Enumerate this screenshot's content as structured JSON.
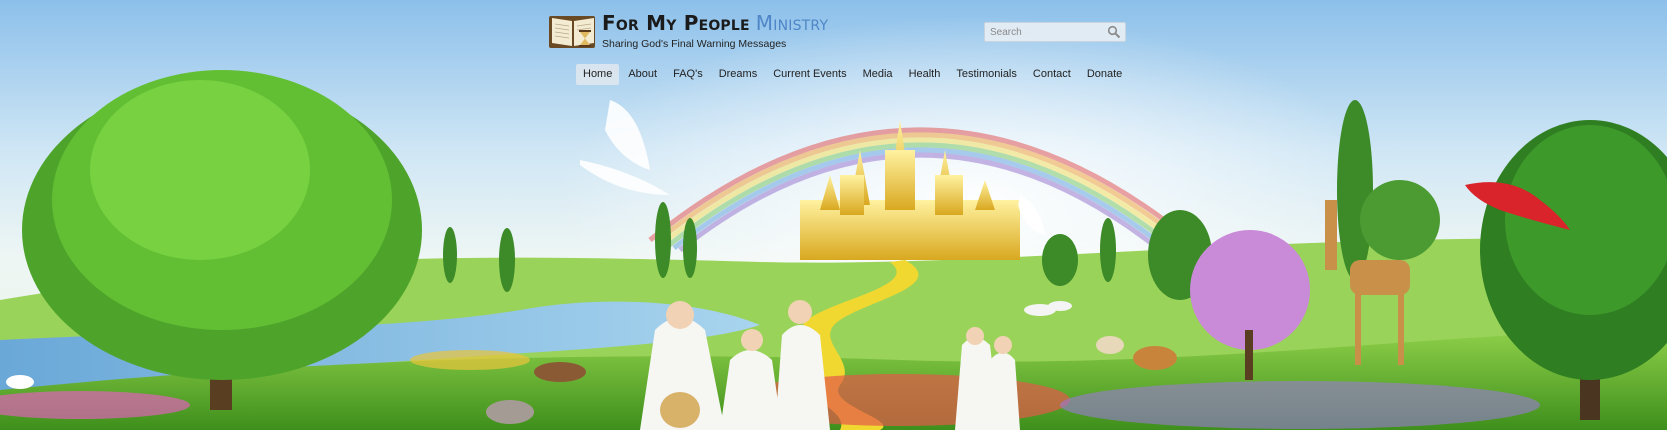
{
  "header": {
    "title_main": "For My People",
    "title_accent": "Ministry",
    "tagline": "Sharing God's Final Warning Messages",
    "logo_icon": "open-book-hourglass-icon"
  },
  "search": {
    "placeholder": "Search",
    "icon": "magnifier-icon"
  },
  "nav": {
    "items": [
      {
        "label": "Home",
        "active": true
      },
      {
        "label": "About"
      },
      {
        "label": "FAQ's"
      },
      {
        "label": "Dreams"
      },
      {
        "label": "Current Events"
      },
      {
        "label": "Media"
      },
      {
        "label": "Health"
      },
      {
        "label": "Testimonials"
      },
      {
        "label": "Contact"
      },
      {
        "label": "Donate"
      }
    ]
  },
  "colors": {
    "accent_blue": "#4f86c7",
    "title_dark": "#1b1b1b",
    "sky_top": "#8cc0ea",
    "grass": "#5fb42a",
    "path_gold": "#f0d830"
  }
}
